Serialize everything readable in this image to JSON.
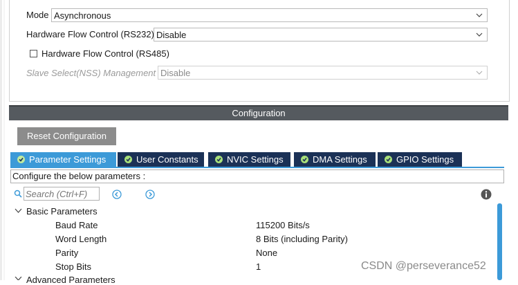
{
  "mode_panel": {
    "mode": {
      "label": "Mode",
      "value": "Asynchronous"
    },
    "hw_flow_rs232": {
      "label": "Hardware Flow Control (RS232)",
      "value": "Disable"
    },
    "hw_flow_rs485": {
      "label": "Hardware Flow Control (RS485)",
      "checked": false
    },
    "slave_select": {
      "label": "Slave Select(NSS) Management",
      "value": "Disable",
      "disabled": true
    }
  },
  "configuration": {
    "title": "Configuration",
    "reset_label": "Reset Configuration",
    "tabs": [
      {
        "label": "Parameter Settings",
        "active": true
      },
      {
        "label": "User Constants",
        "active": false
      },
      {
        "label": "NVIC Settings",
        "active": false
      },
      {
        "label": "DMA Settings",
        "active": false
      },
      {
        "label": "GPIO Settings",
        "active": false
      }
    ],
    "configure_text": "Configure the below parameters :",
    "search_placeholder": "Search (Ctrl+F)",
    "groups": [
      {
        "name": "Basic Parameters",
        "expanded": true,
        "params": [
          {
            "name": "Baud Rate",
            "value": "115200 Bits/s"
          },
          {
            "name": "Word Length",
            "value": "8 Bits (including Parity)"
          },
          {
            "name": "Parity",
            "value": "None"
          },
          {
            "name": "Stop Bits",
            "value": "1"
          }
        ]
      },
      {
        "name": "Advanced Parameters",
        "expanded": true,
        "params": []
      }
    ]
  },
  "watermark": "CSDN @perseverance52",
  "colors": {
    "tab_active": "#3c9ad8",
    "tab_inactive": "#1b3156",
    "config_bar": "#555a5f",
    "reset_button": "#8c8c8c",
    "check_icon": "#a8e07a"
  }
}
